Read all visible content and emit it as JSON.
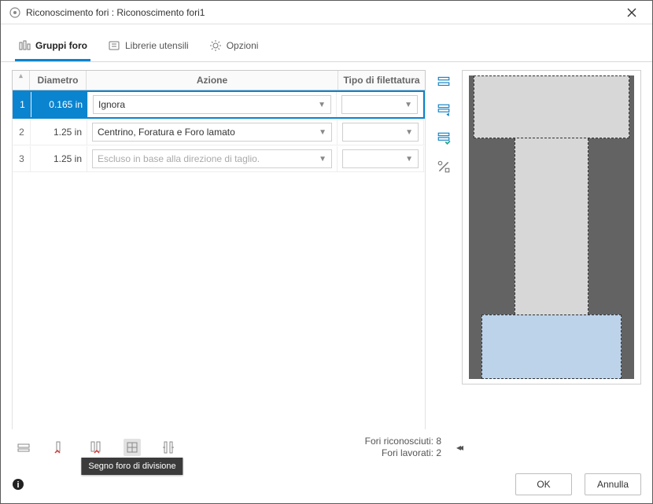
{
  "window": {
    "title": "Riconoscimento fori : Riconoscimento fori1"
  },
  "tabs": {
    "items": [
      {
        "label": "Gruppi foro",
        "icon": "holes-group-icon",
        "active": true
      },
      {
        "label": "Librerie utensili",
        "icon": "tool-library-icon",
        "active": false
      },
      {
        "label": "Opzioni",
        "icon": "gear-icon",
        "active": false
      }
    ]
  },
  "columns": {
    "rownum": "",
    "diametro": "Diametro",
    "azione": "Azione",
    "filettatura": "Tipo di filettatura"
  },
  "rows": [
    {
      "num": "1",
      "diametro": "0.165 in",
      "azione": "Ignora",
      "filettatura": "",
      "selected": true,
      "disabled": false
    },
    {
      "num": "2",
      "diametro": "1.25 in",
      "azione": "Centrino, Foratura e Foro lamato",
      "filettatura": "",
      "selected": false,
      "disabled": false
    },
    {
      "num": "3",
      "diametro": "1.25 in",
      "azione": "Escluso in base alla direzione di taglio.",
      "filettatura": "",
      "selected": false,
      "disabled": true
    }
  ],
  "side_tools": [
    {
      "name": "filter-1-icon"
    },
    {
      "name": "filter-2-icon"
    },
    {
      "name": "filter-3-icon"
    },
    {
      "name": "percent-icon"
    }
  ],
  "footer_tools": {
    "buttons": [
      {
        "name": "tool-split-icon",
        "hover": false
      },
      {
        "name": "tool-col1-icon",
        "hover": false
      },
      {
        "name": "tool-col2-icon",
        "hover": false
      },
      {
        "name": "tool-mark-split-icon",
        "hover": true,
        "tooltip": "Segno foro di divisione"
      },
      {
        "name": "tool-measure-icon",
        "hover": false
      }
    ],
    "status": {
      "recognized_label": "Fori riconosciuti:",
      "recognized_value": "8",
      "machined_label": "Fori lavorati:",
      "machined_value": "2"
    },
    "rewind": "◀◀"
  },
  "dialog": {
    "ok": "OK",
    "cancel": "Annulla"
  }
}
